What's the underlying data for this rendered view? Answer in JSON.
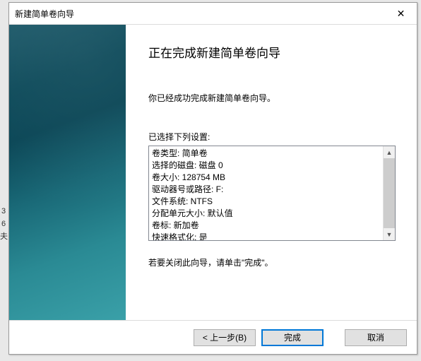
{
  "window": {
    "title": "新建简单卷向导"
  },
  "heading": "正在完成新建简单卷向导",
  "intro": "你已经成功完成新建简单卷向导。",
  "settings_label": "已选择下列设置:",
  "settings": {
    "lines": [
      "卷类型: 简单卷",
      "选择的磁盘: 磁盘 0",
      "卷大小: 128754 MB",
      "驱动器号或路径: F:",
      "文件系统: NTFS",
      "分配单元大小: 默认值",
      "卷标: 新加卷",
      "快速格式化: 是"
    ]
  },
  "closing_hint": "若要关闭此向导，请单击\"完成\"。",
  "buttons": {
    "back": "< 上一步(B)",
    "finish": "完成",
    "cancel": "取消"
  },
  "left_strip": {
    "a": "3",
    "b": "6",
    "c": "夫"
  }
}
